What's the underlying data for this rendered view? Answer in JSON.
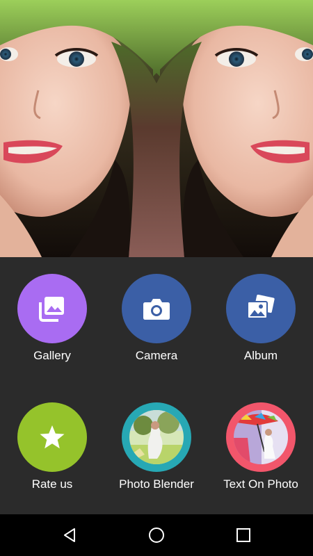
{
  "hero": {
    "image": "mirrored-portrait-photo"
  },
  "menu": {
    "items": [
      {
        "id": "gallery",
        "label": "Gallery",
        "icon": "gallery-icon",
        "color": "#a96cf2"
      },
      {
        "id": "camera",
        "label": "Camera",
        "icon": "camera-icon",
        "color": "#3b5fa6"
      },
      {
        "id": "album",
        "label": "Album",
        "icon": "album-icon",
        "color": "#3b5fa6"
      },
      {
        "id": "rate",
        "label": "Rate us",
        "icon": "star-icon",
        "color": "#95c32b"
      },
      {
        "id": "blender",
        "label": "Photo Blender",
        "icon": "photo-blender-thumbnail",
        "color": "#27a8b4"
      },
      {
        "id": "textonphoto",
        "label": "Text On Photo",
        "icon": "text-on-photo-thumbnail",
        "color": "#f2566b"
      }
    ]
  },
  "navbar": {
    "back": "back-icon",
    "home": "home-icon",
    "recents": "recents-icon"
  },
  "colors": {
    "background": "#2b2b2b",
    "navbar": "#000000",
    "label": "#ffffff"
  }
}
